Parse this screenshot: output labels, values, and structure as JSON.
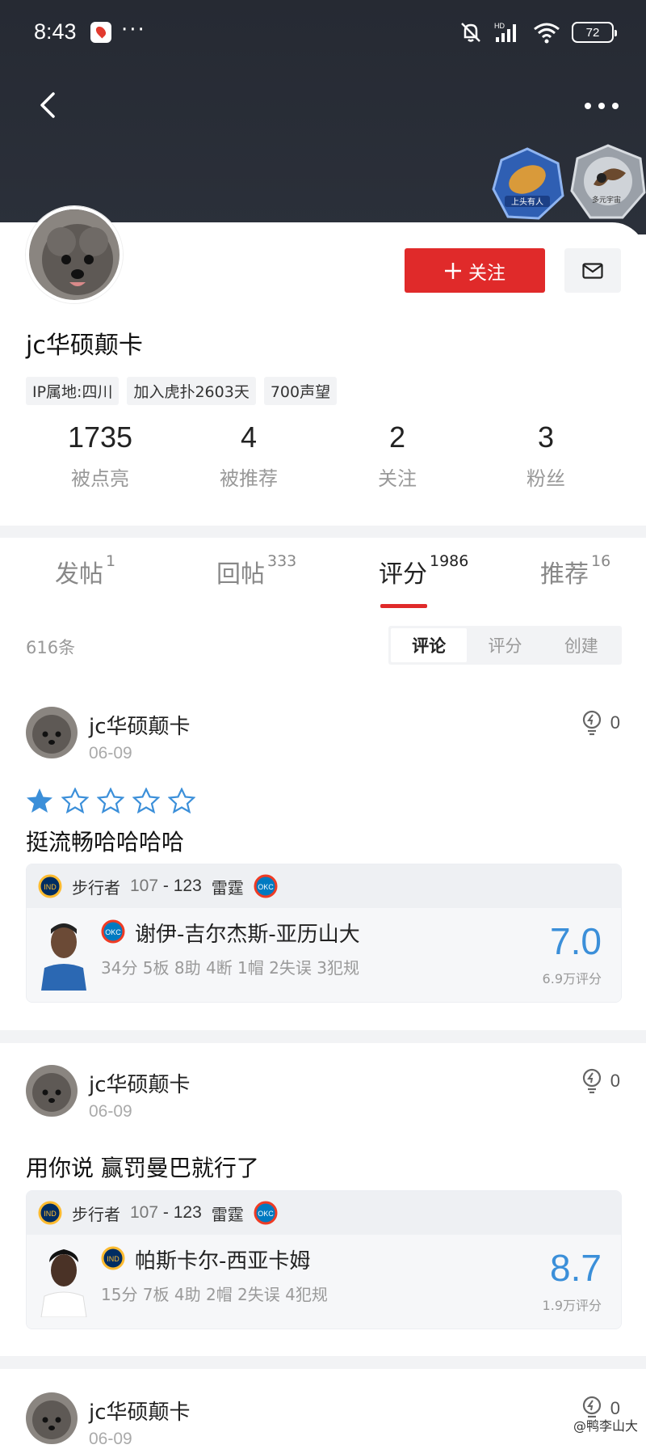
{
  "status_bar": {
    "time": "8:43",
    "more": "···",
    "battery": "72"
  },
  "profile": {
    "username": "jc华硕颠卡",
    "follow_label": "关注",
    "tags": [
      "IP属地:四川",
      "加入虎扑2603天",
      "700声望"
    ],
    "stats": [
      {
        "num": "1735",
        "label": "被点亮"
      },
      {
        "num": "4",
        "label": "被推荐"
      },
      {
        "num": "2",
        "label": "关注"
      },
      {
        "num": "3",
        "label": "粉丝"
      }
    ]
  },
  "tabs": [
    {
      "label": "发帖",
      "count": "1"
    },
    {
      "label": "回帖",
      "count": "333"
    },
    {
      "label": "评分",
      "count": "1986",
      "active": true
    },
    {
      "label": "推荐",
      "count": "16"
    }
  ],
  "list": {
    "count": "616条",
    "segments": [
      "评论",
      "评分",
      "创建"
    ],
    "active_segment": "评论"
  },
  "posts": [
    {
      "author": "jc华硕颠卡",
      "date": "06-09",
      "likes": "0",
      "stars": 1,
      "text": "挺流畅哈哈哈哈",
      "home_team": "步行者",
      "home_abbr": "IND",
      "home_score": "107",
      "away_team": "雷霆",
      "away_abbr": "OKC",
      "away_score": "123",
      "player": "谢伊-吉尔杰斯-亚历山大",
      "player_team": "OKC",
      "statline": "34分 5板 8助 4断 1帽 2失误 3犯规",
      "rating": "7.0",
      "rating_count": "6.9万评分"
    },
    {
      "author": "jc华硕颠卡",
      "date": "06-09",
      "likes": "0",
      "text": "用你说 赢罚曼巴就行了",
      "home_team": "步行者",
      "home_abbr": "IND",
      "home_score": "107",
      "away_team": "雷霆",
      "away_abbr": "OKC",
      "away_score": "123",
      "player": "帕斯卡尔-西亚卡姆",
      "player_team": "IND",
      "statline": "15分 7板 4助 2帽 2失误 4犯规",
      "rating": "8.7",
      "rating_count": "1.9万评分"
    },
    {
      "author": "jc华硕颠卡",
      "date": "06-09",
      "likes": "0"
    }
  ],
  "badges": [
    "上头有人",
    "多元宇宙"
  ],
  "watermark": "@鸭李山大",
  "colors": {
    "accent_red": "#e02a2a",
    "rating_blue": "#3b8fd9",
    "header_bg": "#262a33"
  }
}
